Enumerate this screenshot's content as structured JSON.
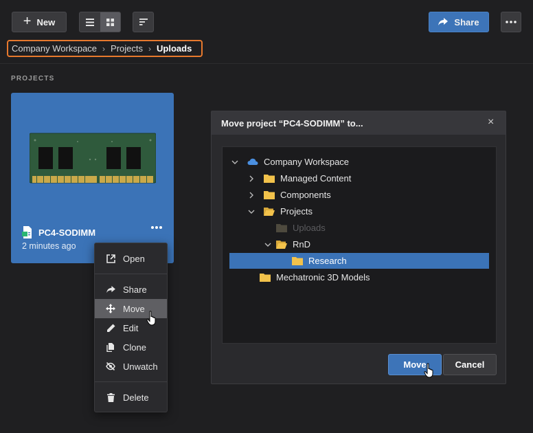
{
  "toolbar": {
    "new_label": "New",
    "share_label": "Share"
  },
  "breadcrumb": {
    "items": [
      "Company Workspace",
      "Projects",
      "Uploads"
    ]
  },
  "section": {
    "label": "PROJECTS"
  },
  "card": {
    "title": "PC4-SODIMM",
    "subtitle": "2 minutes ago"
  },
  "context_menu": {
    "items": [
      {
        "label": "Open",
        "icon": "open-external-icon"
      },
      {
        "label": "Share",
        "icon": "share-icon"
      },
      {
        "label": "Move",
        "icon": "move-icon"
      },
      {
        "label": "Edit",
        "icon": "pencil-icon"
      },
      {
        "label": "Clone",
        "icon": "clone-icon"
      },
      {
        "label": "Unwatch",
        "icon": "unwatch-icon"
      },
      {
        "label": "Delete",
        "icon": "trash-icon"
      }
    ],
    "hovered": "Move"
  },
  "dialog": {
    "title": "Move project “PC4-SODIMM” to...",
    "close_glyph": "×",
    "tree": [
      {
        "label": "Company Workspace",
        "icon": "cloud-icon"
      },
      {
        "label": "Managed Content",
        "icon": "folder-icon"
      },
      {
        "label": "Components",
        "icon": "folder-icon"
      },
      {
        "label": "Projects",
        "icon": "folder-open-icon"
      },
      {
        "label": "Uploads",
        "icon": "folder-icon"
      },
      {
        "label": "RnD",
        "icon": "folder-open-icon"
      },
      {
        "label": "Research",
        "icon": "folder-icon"
      },
      {
        "label": "Mechatronic 3D Models",
        "icon": "folder-icon"
      }
    ],
    "selected": "Research",
    "move_label": "Move",
    "cancel_label": "Cancel"
  },
  "colors": {
    "accent": "#3d74b8",
    "card": "#3b73b7",
    "highlight_border": "#e8792d",
    "folder": "#f2c24b"
  }
}
